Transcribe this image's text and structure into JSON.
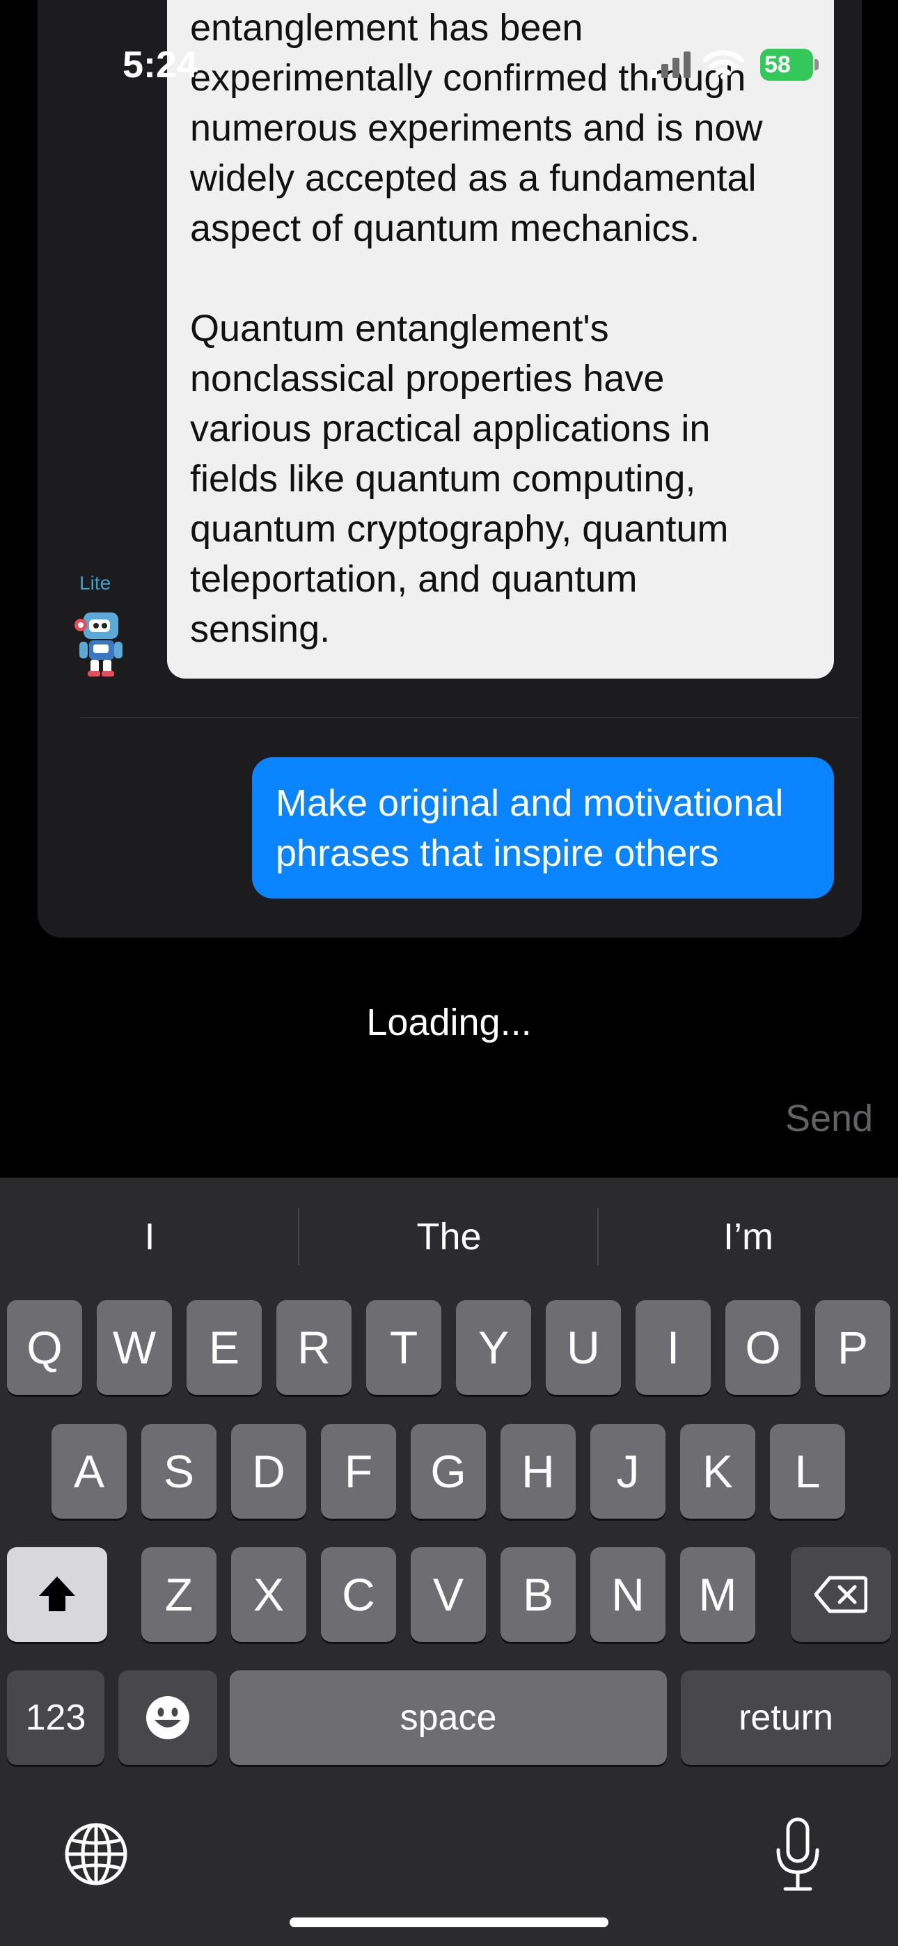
{
  "status_bar": {
    "time": "5:24",
    "battery": "58"
  },
  "chat": {
    "ai_message": "entanglement has been\nexperimentally confirmed through\nnumerous experiments and is now\nwidely accepted as a fundamental\naspect of quantum mechanics.\n\nQuantum entanglement's\nnonclassical properties have\nvarious practical applications in\nfields like quantum computing,\nquantum cryptography, quantum\nteleportation, and quantum\nsensing.",
    "model_tag": "Lite",
    "user_message": "Make original and motivational\nphrases that inspire others"
  },
  "loading_text": "Loading...",
  "send_label": "Send",
  "keyboard": {
    "suggestions": [
      "I",
      "The",
      "I’m"
    ],
    "row1": [
      "Q",
      "W",
      "E",
      "R",
      "T",
      "Y",
      "U",
      "I",
      "O",
      "P"
    ],
    "row2": [
      "A",
      "S",
      "D",
      "F",
      "G",
      "H",
      "J",
      "K",
      "L"
    ],
    "row3": [
      "Z",
      "X",
      "C",
      "V",
      "B",
      "N",
      "M"
    ],
    "numbers_label": "123",
    "space_label": "space",
    "return_label": "return"
  },
  "colors": {
    "user_bubble": "#0a84ff",
    "ai_bubble": "#f0f0f0",
    "model_tag": "#3da0c6",
    "battery": "#34c759"
  },
  "icons": [
    "robot-avatar",
    "signal-icon",
    "wifi-icon",
    "battery-icon",
    "shift-icon",
    "backspace-icon",
    "emoji-icon",
    "globe-icon",
    "mic-icon"
  ]
}
